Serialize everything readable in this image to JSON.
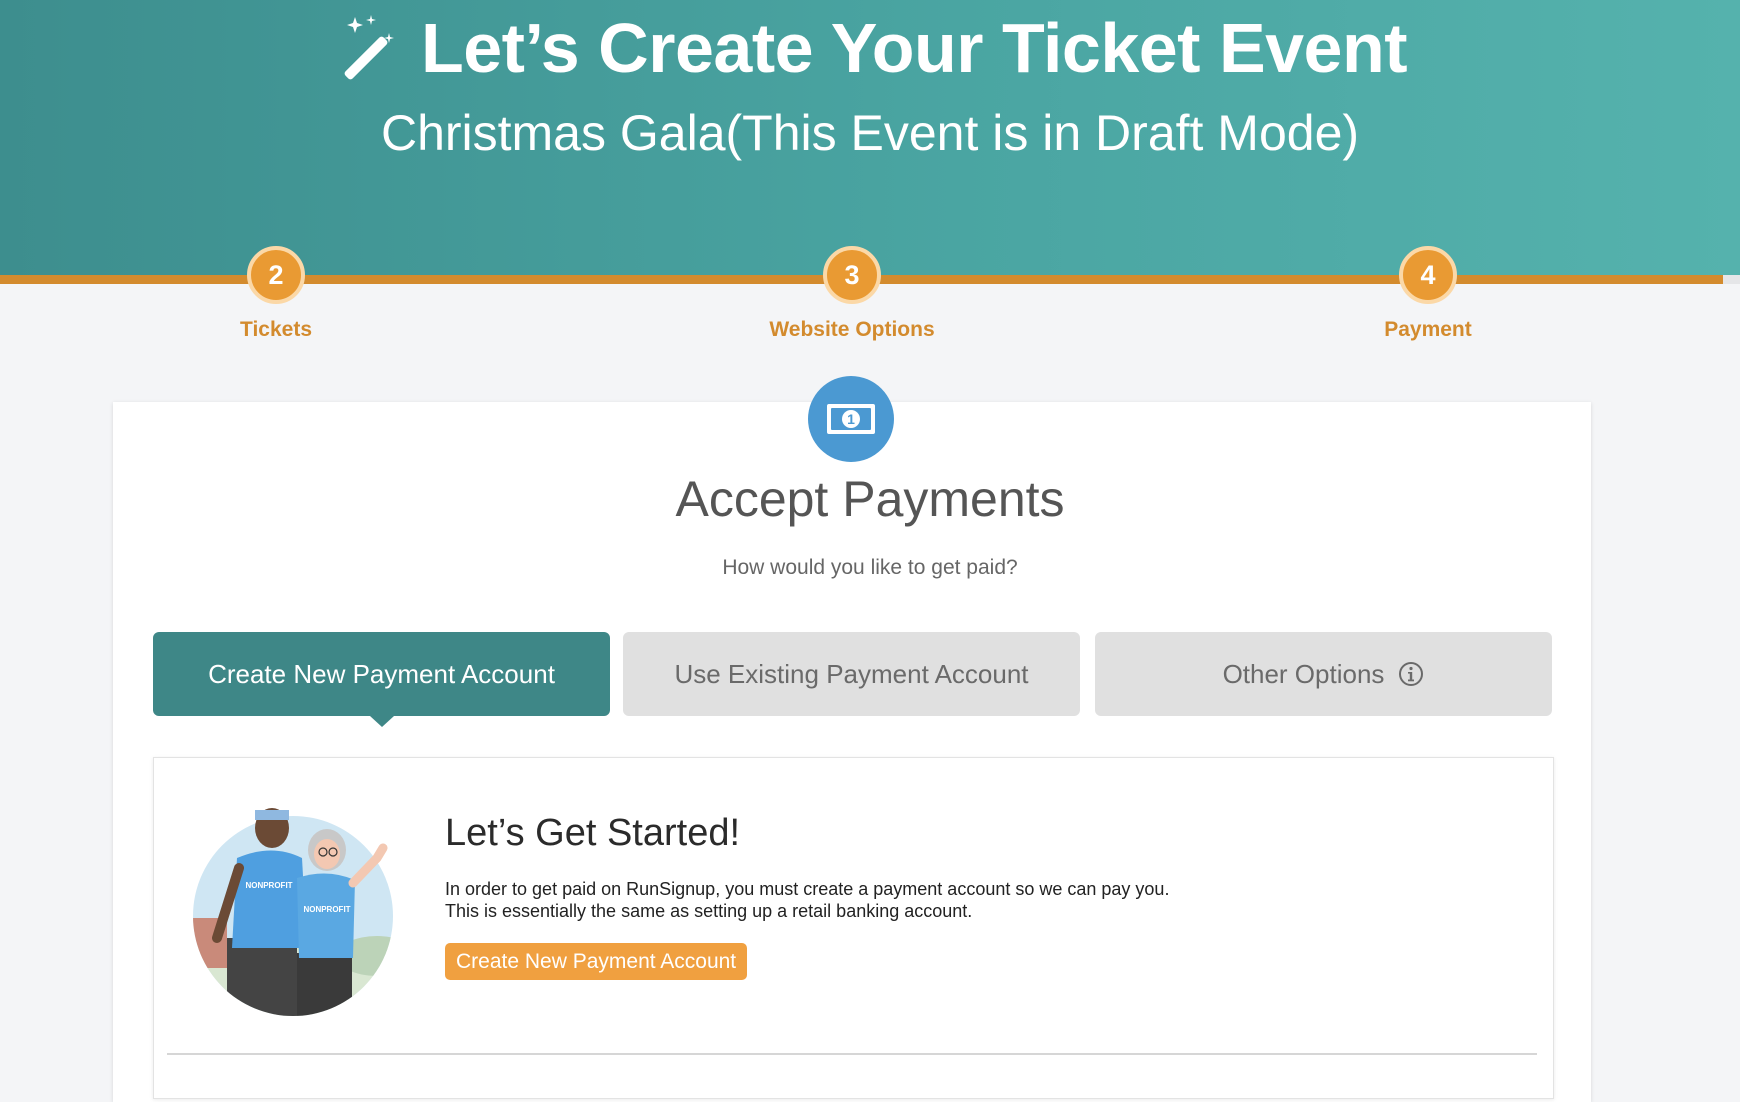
{
  "header": {
    "title": "Let’s Create Your Ticket Event",
    "subtitle": "Christmas Gala(This Event is in Draft Mode)",
    "title_icon": "magic-wand-icon",
    "background_colors": [
      "#3d8e8e",
      "#55b2ad"
    ]
  },
  "progress": {
    "fill_fraction": 0.99,
    "accent": "#d38b2e",
    "steps": [
      {
        "number": "2",
        "label": "Tickets"
      },
      {
        "number": "3",
        "label": "Website Options"
      },
      {
        "number": "4",
        "label": "Payment"
      }
    ]
  },
  "payments": {
    "icon": "money-bill-icon",
    "title": "Accept Payments",
    "subtitle": "How would you like to get paid?",
    "tabs": [
      {
        "label": "Create New Payment Account",
        "active": true
      },
      {
        "label": "Use Existing Payment Account",
        "active": false
      },
      {
        "label": "Other Options",
        "active": false,
        "icon": "info-icon"
      }
    ]
  },
  "get_started": {
    "title": "Let’s Get Started!",
    "description_lines": [
      "In order to get paid on RunSignup, you must create a payment account so we can pay you.",
      "This is essentially the same as setting up a retail banking account."
    ],
    "button_label": "Create New Payment Account",
    "button_color": "#f0a040",
    "illustration": {
      "shirt_text": "NONPROFIT"
    }
  }
}
